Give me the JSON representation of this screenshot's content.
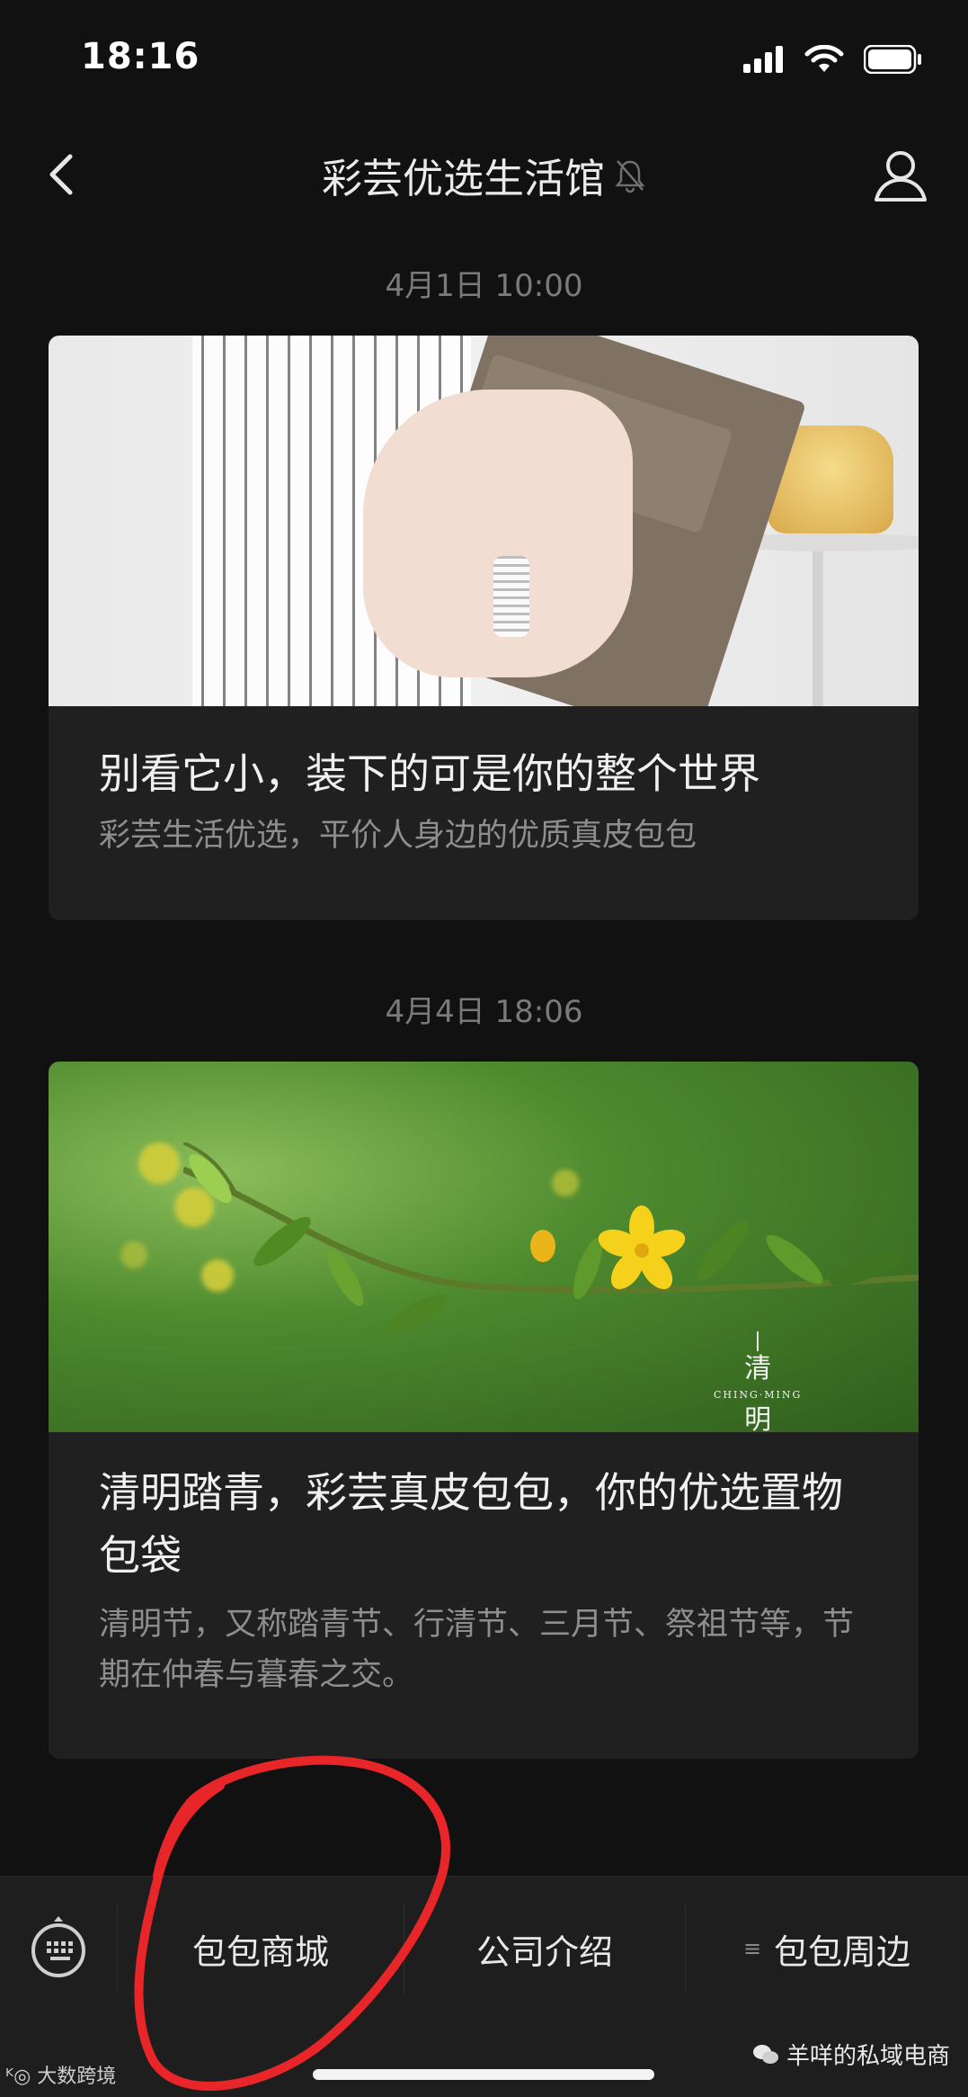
{
  "status_bar": {
    "time": "18:16"
  },
  "nav": {
    "title": "彩芸优选生活馆"
  },
  "messages": [
    {
      "timestamp": "4月1日 10:00",
      "title": "别看它小，装下的可是你的整个世界",
      "description": "彩芸生活优选，平价人身边的优质真皮包包"
    },
    {
      "timestamp": "4月4日 18:06",
      "title": "清明踏青，彩芸真皮包包，你的优选置物包袋",
      "description": "清明节，又称踏青节、行清节、三月节、祭祖节等，节期在仲春与暮春之交。",
      "image_caption": {
        "char1": "清",
        "sub": "CHING·MING",
        "char2": "明"
      }
    }
  ],
  "menu": {
    "items": [
      {
        "label": "包包商城"
      },
      {
        "label": "公司介绍"
      },
      {
        "label": "包包周边"
      }
    ]
  },
  "watermarks": {
    "left": "大数跨境",
    "right": "羊咩的私域电商"
  },
  "colors": {
    "background": "#111111",
    "card": "#202020",
    "annotation": "#e8262a"
  },
  "icons": [
    "back-chevron-icon",
    "mute-bell-icon",
    "profile-icon",
    "keyboard-icon",
    "signal-icon",
    "wifi-icon",
    "battery-icon"
  ]
}
